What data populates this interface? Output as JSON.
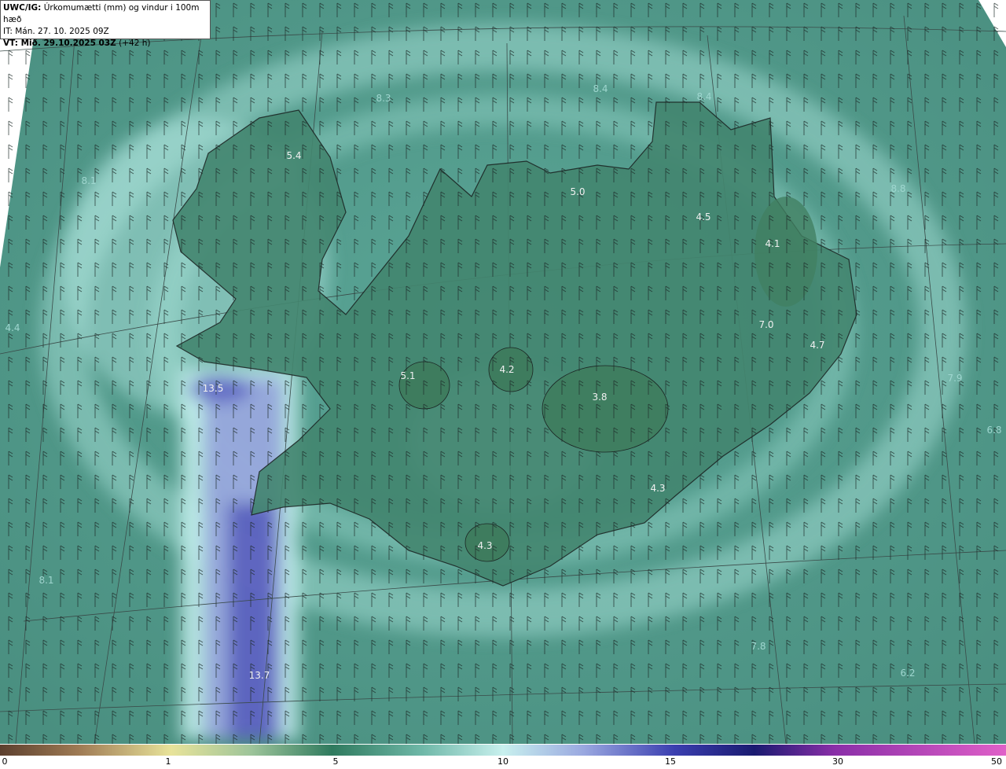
{
  "header": {
    "model": "UWC/IG:",
    "title": "Úrkomumætti (mm) og vindur i 100m hæð",
    "init_time": "IT: Mán. 27. 10. 2025 09Z",
    "valid_prefix": "VT: Mið. 29.10.2025 03Z",
    "valid_suffix": "(+42 h)"
  },
  "map_labels": [
    "5.4",
    "8.1",
    "5.0",
    "4.5",
    "4.1",
    "7.0",
    "4.7",
    "4.2",
    "5.1",
    "13.5",
    "3.8",
    "4.3",
    "4.3",
    "7.9",
    "6.8",
    "8.1",
    "7.8",
    "13.7",
    "6.2",
    "4.4",
    "8.4",
    "8.4",
    "8.3",
    "8.8"
  ],
  "colorbar": {
    "ticks": [
      "0",
      "1",
      "5",
      "10",
      "15",
      "30",
      "50"
    ],
    "colors": [
      "#5c3f2e",
      "#a07c55",
      "#d9c07a",
      "#e8e39a",
      "#2f7a5e",
      "#6fb8a8",
      "#c8f0ee",
      "#9aa8e0",
      "#3b3fb0",
      "#8a2fa8",
      "#e060c8"
    ]
  }
}
